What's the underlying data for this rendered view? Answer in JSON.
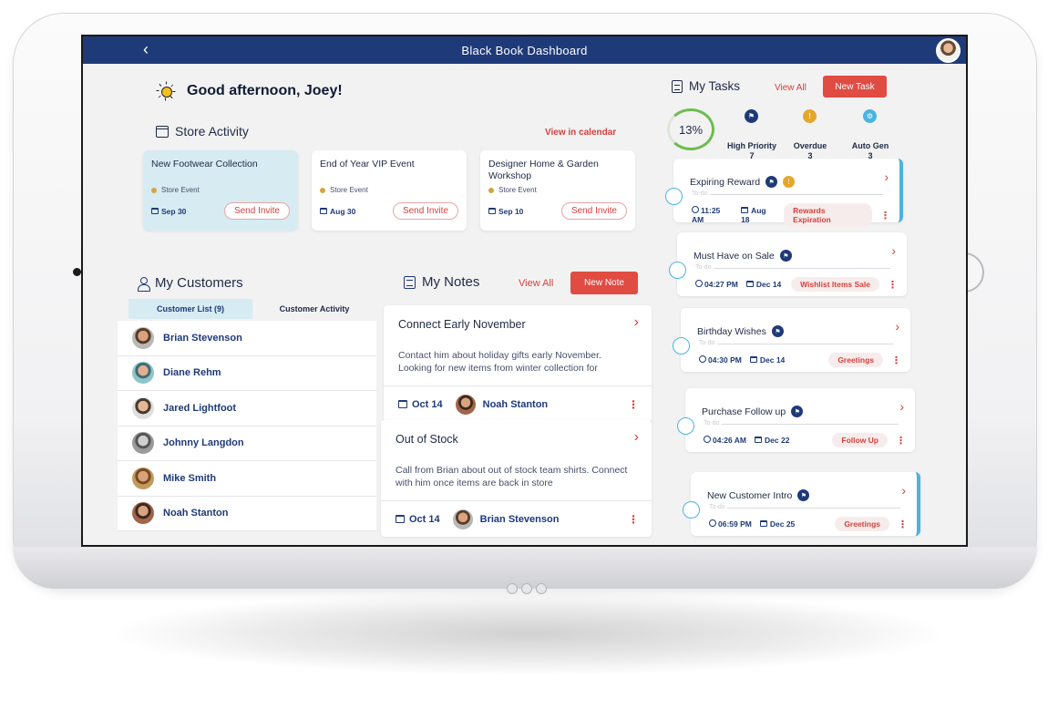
{
  "app": {
    "title": "Black Book Dashboard"
  },
  "greeting": "Good afternoon, Joey!",
  "store_activity": {
    "title": "Store Activity",
    "link": "View in calendar",
    "events": [
      {
        "title": "New Footwear Collection",
        "type": "Store Event",
        "date": "Sep 30",
        "action": "Send Invite"
      },
      {
        "title": "End of Year VIP Event",
        "type": "Store Event",
        "date": "Aug 30",
        "action": "Send Invite"
      },
      {
        "title": "Designer Home & Garden Workshop",
        "type": "Store Event",
        "date": "Sep 10",
        "action": "Send Invite"
      }
    ]
  },
  "customers": {
    "title": "My Customers",
    "tabs": [
      "Customer List (9)",
      "Customer Activity"
    ],
    "list": [
      "Brian Stevenson",
      "Diane Rehm",
      "Jared Lightfoot",
      "Johnny Langdon",
      "Mike Smith",
      "Noah Stanton"
    ]
  },
  "notes": {
    "title": "My Notes",
    "view_all": "View All",
    "new_label": "New Note",
    "items": [
      {
        "title": "Connect Early November",
        "body": "Contact him about holiday gifts early November. Looking for new items from winter collection for",
        "date": "Oct 14",
        "customer": "Noah Stanton"
      },
      {
        "title": "Out of Stock",
        "body": "Call from Brian about out of stock team shirts. Connect with him once items are back in store",
        "date": "Oct 14",
        "customer": "Brian Stevenson"
      }
    ]
  },
  "tasks": {
    "title": "My Tasks",
    "view_all": "View All",
    "new_label": "New Task",
    "progress": "13%",
    "progress_value": 0.13,
    "stats": [
      {
        "label": "High Priority",
        "count": "7",
        "icon": "flag-icon",
        "color": "#1e3a78"
      },
      {
        "label": "Overdue",
        "count": "3",
        "icon": "exclamation-icon",
        "color": "#e5a72b"
      },
      {
        "label": "Auto Gen",
        "count": "3",
        "icon": "gear-icon",
        "color": "#4bb3e0"
      }
    ],
    "items": [
      {
        "title": "Expiring Reward",
        "status": "To-do",
        "time": "11:25 AM",
        "date": "Aug 18",
        "tag": "Rewards Expiration"
      },
      {
        "title": "Must Have on Sale",
        "status": "To-do",
        "time": "04:27 PM",
        "date": "Dec 14",
        "tag": "Wishlist Items Sale"
      },
      {
        "title": "Birthday Wishes",
        "status": "To-do",
        "time": "04:30 PM",
        "date": "Dec 14",
        "tag": "Greetings"
      },
      {
        "title": "Purchase Follow up",
        "status": "To-do",
        "time": "04:26 AM",
        "date": "Dec 22",
        "tag": "Follow Up"
      },
      {
        "title": "New Customer Intro",
        "status": "To-do",
        "time": "06:59 PM",
        "date": "Dec 25",
        "tag": "Greetings"
      }
    ]
  },
  "colors": {
    "navy": "#1e3a78",
    "accent_red": "#e04b42",
    "accent_blue": "#4bb3e0",
    "gold": "#e5a72b",
    "progress_green": "#6ebd4f"
  }
}
